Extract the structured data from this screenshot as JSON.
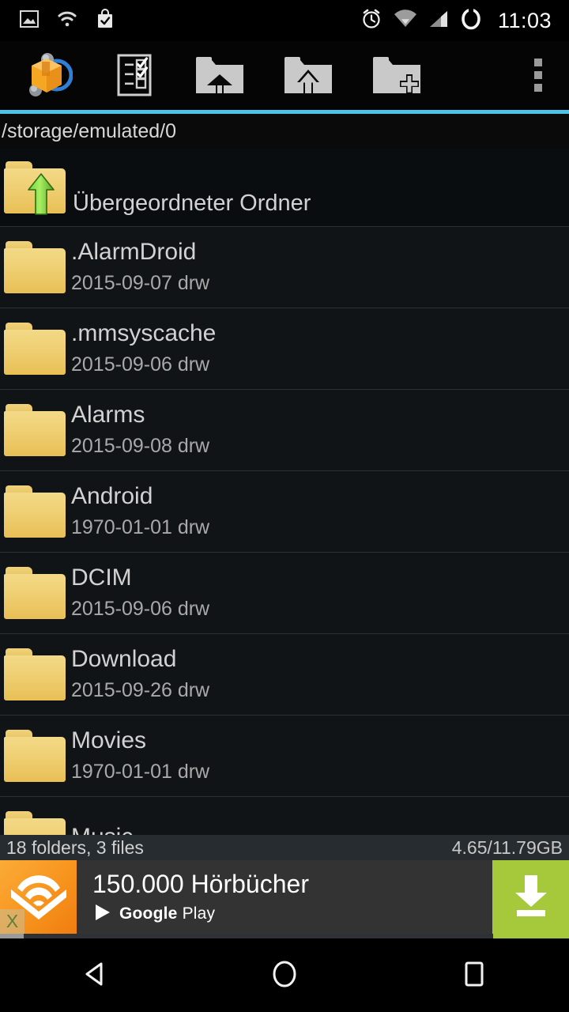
{
  "statusbar": {
    "time": "11:03",
    "left_icons": [
      {
        "name": "screenshot-icon",
        "label": "screenshot"
      },
      {
        "name": "wifi-icon",
        "label": "wifi"
      },
      {
        "name": "play-store-bag-icon",
        "label": "play-store"
      }
    ],
    "right_icons": [
      {
        "name": "alarm-icon",
        "label": "alarm"
      },
      {
        "name": "wifi-signal-icon",
        "label": "wifi signal"
      },
      {
        "name": "cellular-signal-icon",
        "label": "cellular signal"
      },
      {
        "name": "battery-circle-icon",
        "label": "battery"
      }
    ]
  },
  "toolbar": {
    "app_logo": "androzip-box-icon",
    "select_label": "Auswählen",
    "home_label": "Start-Ordner",
    "up_label": "Übergeordneter Ordner",
    "new_folder_label": "Neuer Ordner",
    "overflow_label": "Weitere Optionen",
    "accent_color": "#4ec3ea"
  },
  "path": {
    "current": "/storage/emulated/0"
  },
  "filelist": {
    "rows": [
      {
        "name": "Übergeordneter Ordner",
        "sub": "",
        "icon": "folder-up-icon"
      },
      {
        "name": ".AlarmDroid",
        "sub": "2015-09-07 drw",
        "icon": "folder-icon"
      },
      {
        "name": ".mmsyscache",
        "sub": "2015-09-06 drw",
        "icon": "folder-icon"
      },
      {
        "name": "Alarms",
        "sub": "2015-09-08 drw",
        "icon": "folder-icon"
      },
      {
        "name": "Android",
        "sub": "1970-01-01 drw",
        "icon": "folder-icon"
      },
      {
        "name": "DCIM",
        "sub": "2015-09-06 drw",
        "icon": "folder-icon"
      },
      {
        "name": "Download",
        "sub": "2015-09-26 drw",
        "icon": "folder-icon"
      },
      {
        "name": "Movies",
        "sub": "1970-01-01 drw",
        "icon": "folder-icon"
      },
      {
        "name": "Music",
        "sub": "",
        "icon": "folder-icon"
      }
    ]
  },
  "infobar": {
    "counts": "18 folders, 3 files",
    "storage": "4.65/11.79GB"
  },
  "ad": {
    "title": "150.000 Hörbücher",
    "brand_google": "Google",
    "brand_play": "Play",
    "close_label": "X",
    "cta_label": "Installieren",
    "logo_name": "audible-logo-icon",
    "accent_green": "#a5c93b",
    "accent_orange": "#f7941d"
  },
  "navbar": {
    "back_label": "Zurück",
    "home_label": "Startbildschirm",
    "recents_label": "Übersicht"
  }
}
